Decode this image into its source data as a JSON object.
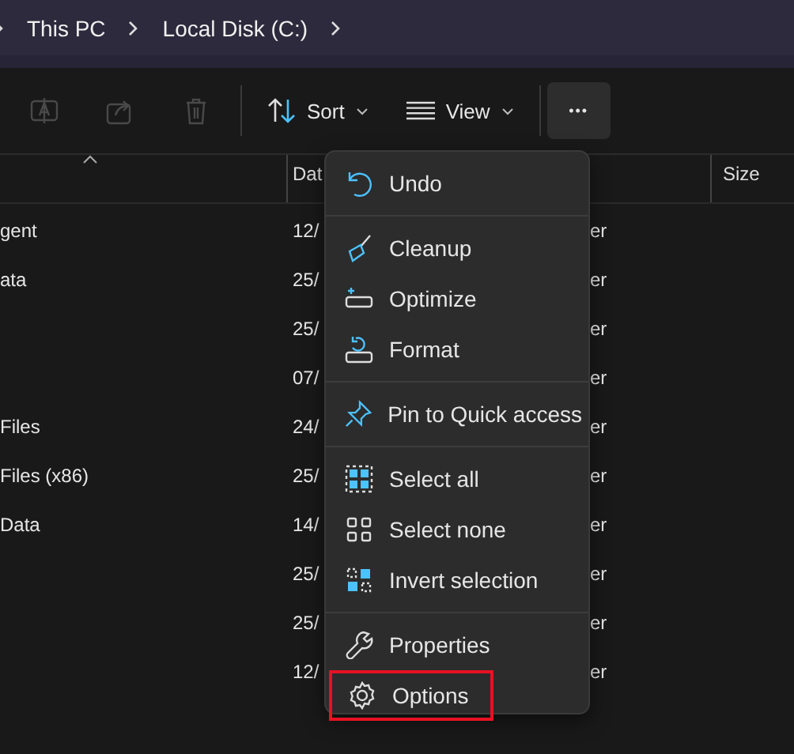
{
  "breadcrumb": [
    "This PC",
    "Local Disk (C:)"
  ],
  "toolbar": [
    {
      "kind": "rename",
      "disabled": true
    },
    {
      "kind": "share",
      "disabled": true
    },
    {
      "kind": "delete",
      "disabled": true
    },
    {
      "kind": "sort",
      "label": "Sort"
    },
    {
      "kind": "view",
      "label": "View"
    },
    {
      "kind": "more",
      "label": "•••",
      "selected": true
    }
  ],
  "table": {
    "columns": [
      "Dat",
      "Size"
    ],
    "rows": [
      {
        "name": "gent",
        "date": "12/",
        "type": "er"
      },
      {
        "name": "ata",
        "date": "25/",
        "type": "er"
      },
      {
        "name": "",
        "date": "25/",
        "type": "er"
      },
      {
        "name": "",
        "date": "07/",
        "type": "er"
      },
      {
        "name": "Files",
        "date": "24/",
        "type": "er"
      },
      {
        "name": "Files (x86)",
        "date": "25/",
        "type": "er"
      },
      {
        "name": "Data",
        "date": "14/",
        "type": "er"
      },
      {
        "name": "",
        "date": "25/",
        "type": "er"
      },
      {
        "name": "",
        "date": "25/",
        "type": "er"
      },
      {
        "name": "",
        "date": "12/",
        "type": "er"
      }
    ]
  },
  "menu": [
    [
      {
        "kind": "undo",
        "label": "Undo",
        "highlighted": false
      }
    ],
    [
      {
        "kind": "cleanup",
        "label": "Cleanup",
        "highlighted": false
      },
      {
        "kind": "optimize",
        "label": "Optimize",
        "highlighted": false
      },
      {
        "kind": "format",
        "label": "Format",
        "highlighted": false
      }
    ],
    [
      {
        "kind": "pin",
        "label": "Pin to Quick access",
        "highlighted": false
      }
    ],
    [
      {
        "kind": "select-all",
        "label": "Select all",
        "highlighted": false
      },
      {
        "kind": "select-none",
        "label": "Select none",
        "highlighted": false
      },
      {
        "kind": "invert",
        "label": "Invert selection",
        "highlighted": false
      }
    ],
    [
      {
        "kind": "properties",
        "label": "Properties",
        "highlighted": false
      },
      {
        "kind": "options",
        "label": "Options",
        "highlighted": true
      }
    ]
  ]
}
